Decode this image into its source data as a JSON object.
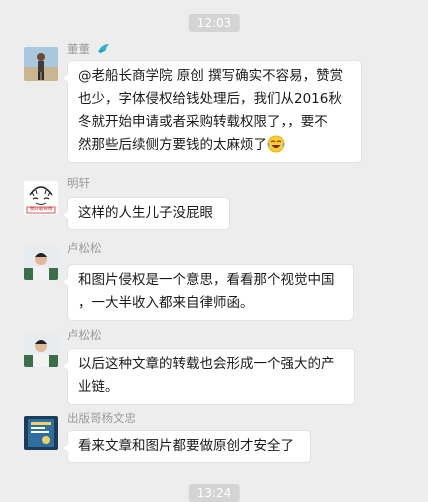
{
  "timestamps": [
    "12:03",
    "13:24"
  ],
  "messages": [
    {
      "sender": "董董",
      "sender_badge_icon": "bird-icon",
      "avatar_icon": "person-photo-avatar",
      "lines": [
        "@老船长商学院 原创 撰写确实不容易，赞赏",
        "也少，字体侵权给钱处理后，我们从2016秋",
        "冬就开始申请或者采购转载权限了，，要不",
        "然那些后续侧方要钱的太麻烦了"
      ],
      "trailing_emoji": "tears-of-joy-emoji"
    },
    {
      "sender": "明轩",
      "avatar_icon": "cartoon-face-avatar",
      "avatar_caption": "我好敢辣哦",
      "lines": [
        "这样的人生儿子没屁眼"
      ]
    },
    {
      "sender": "卢松松",
      "avatar_icon": "person-photo-avatar",
      "lines": [
        "和图片侵权是一个意思，看看那个视觉中国",
        "，一大半收入都来自律师函。"
      ]
    },
    {
      "sender": "卢松松",
      "avatar_icon": "person-photo-avatar",
      "lines": [
        "以后这种文章的转载也会形成一个强大的产",
        "业链。"
      ]
    },
    {
      "sender": "出版哥杨文忠",
      "avatar_icon": "book-cover-avatar",
      "lines": [
        "看来文章和图片都要做原创才安全了"
      ]
    }
  ]
}
